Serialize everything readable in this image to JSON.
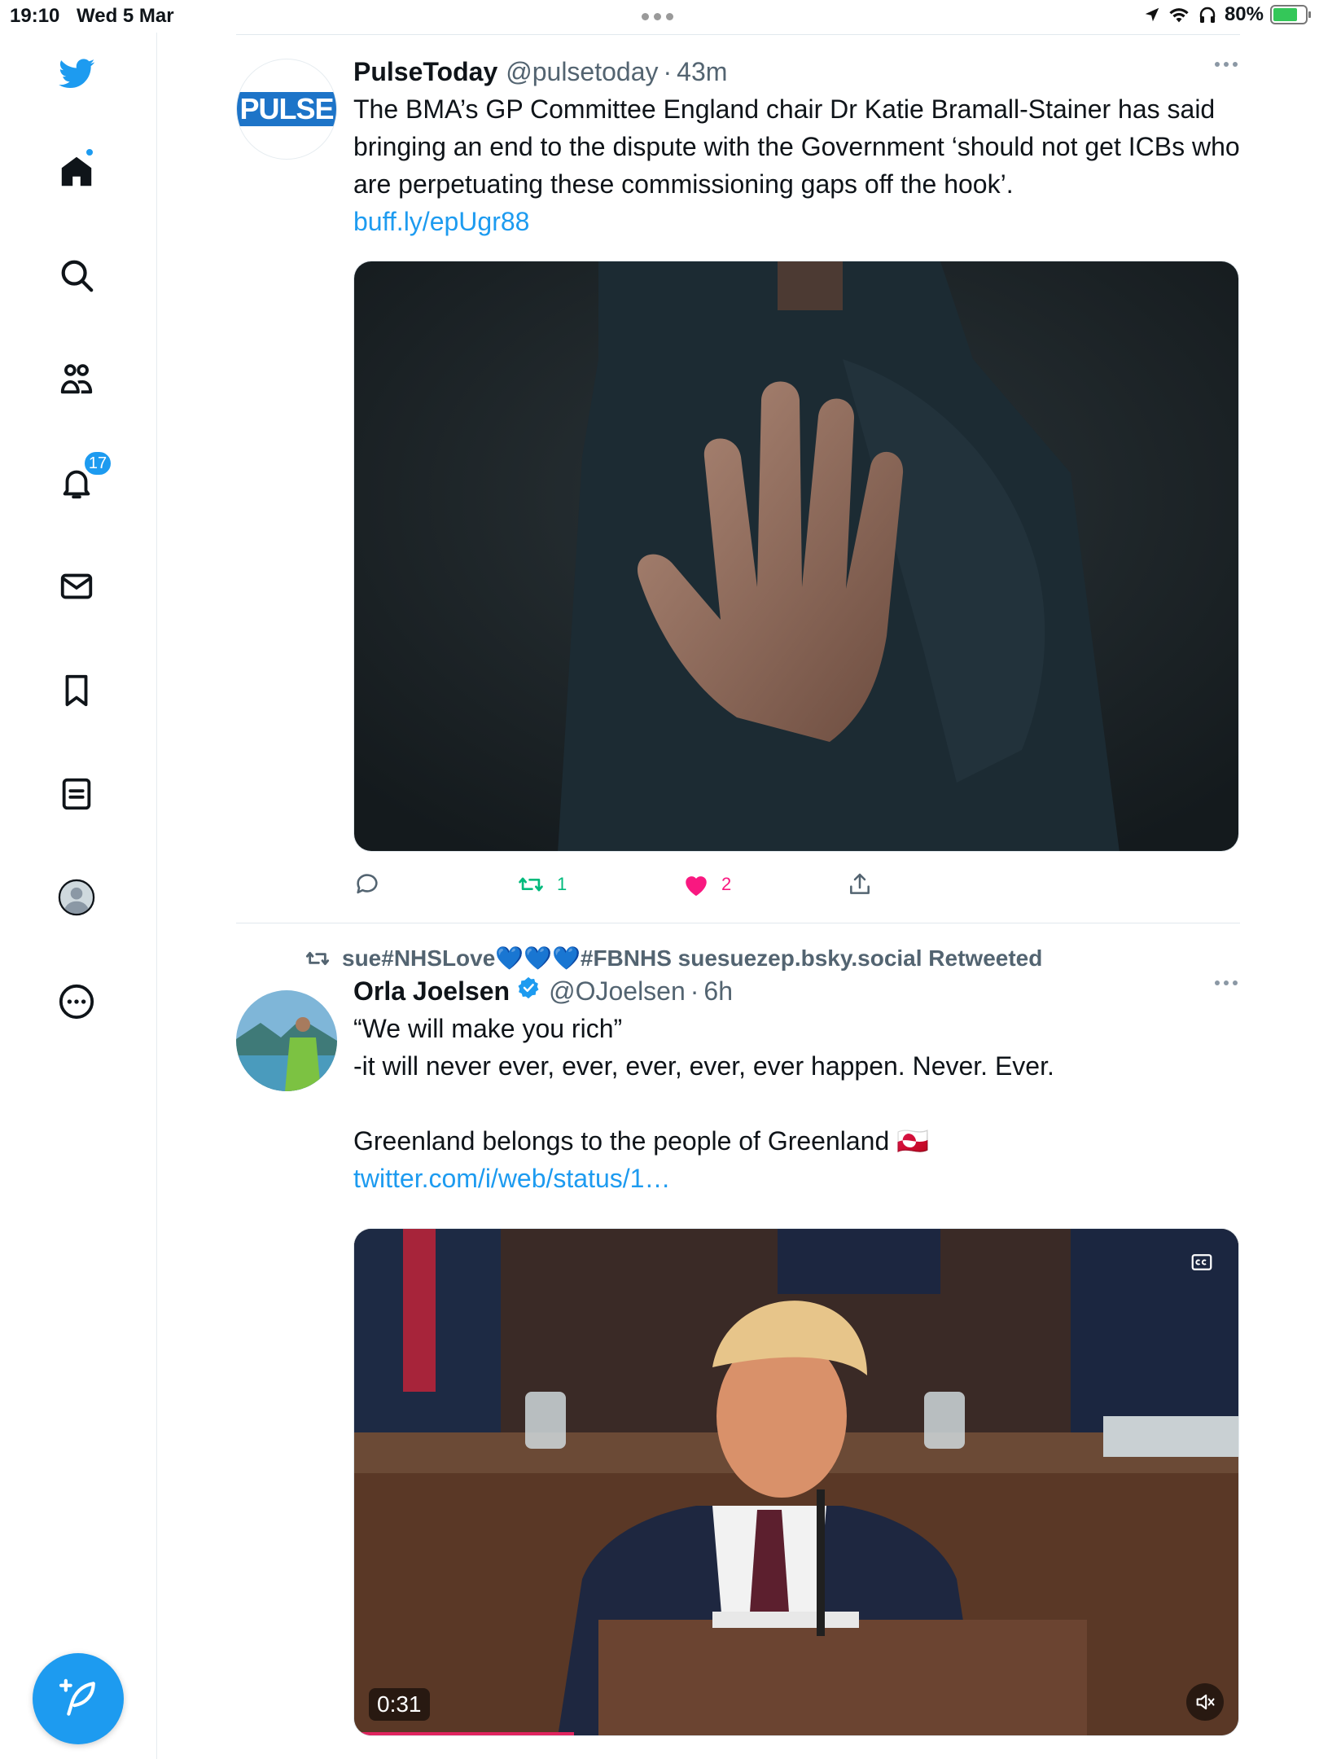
{
  "status_bar": {
    "time": "19:10",
    "date": "Wed 5 Mar",
    "battery": "80%"
  },
  "sidebar": {
    "notifications_badge": "17",
    "items": [
      "home-icon",
      "search-icon",
      "communities-icon",
      "notifications-icon",
      "messages-icon",
      "bookmarks-icon",
      "lists-icon",
      "profile-icon",
      "more-icon"
    ]
  },
  "tweets": [
    {
      "name": "PulseToday",
      "handle": "@pulsetoday",
      "time": "43m",
      "avatar_text": "PULSE",
      "text": "The BMA’s GP Committee England chair Dr Katie Bramall-Stainer has said bringing an end to the dispute with the Government ‘should not get ICBs who are perpetuating these commissioning gaps off the hook’.",
      "link": "buff.ly/epUgr88",
      "retweets": "1",
      "likes": "2"
    },
    {
      "retweeted_by": "sue#NHSLove💙💙💙#FBNHS suesuezep.bsky.social Retweeted",
      "name": "Orla Joelsen",
      "handle": "@OJoelsen",
      "time": "6h",
      "text_line1": "“We will make you rich”",
      "text_line2": "-it will never ever, ever, ever, ever, ever happen. Never. Ever.",
      "text_line3": "Greenland belongs to the people of Greenland 🇬🇱",
      "link": "twitter.com/i/web/status/1…",
      "video_time": "0:31",
      "video_progress": 0.25
    }
  ],
  "colors": {
    "accent": "#1d9bf0",
    "like": "#f91880",
    "retweet": "#00ba7c"
  }
}
